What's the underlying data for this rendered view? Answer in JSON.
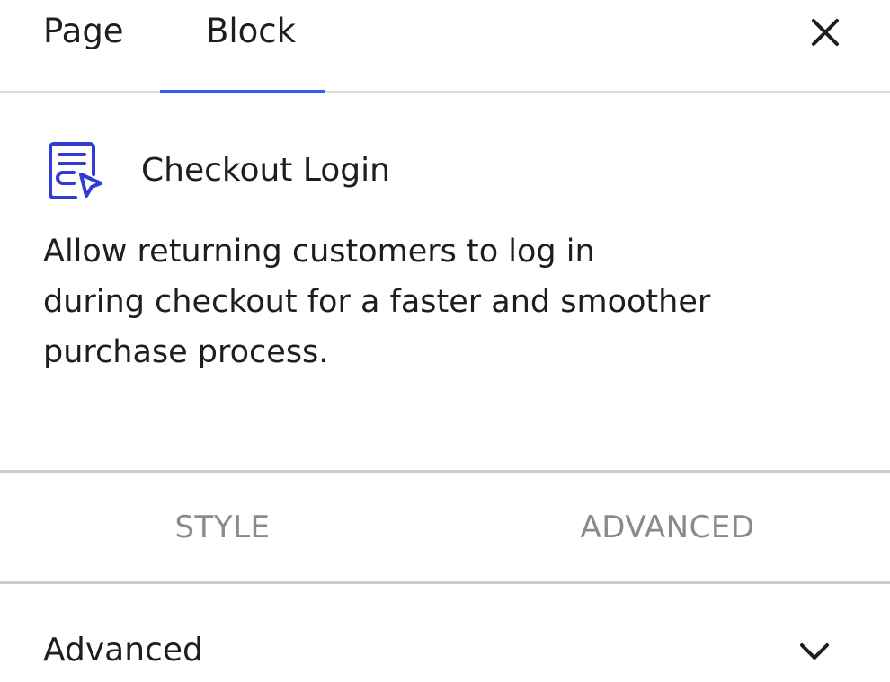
{
  "header": {
    "tabs": [
      {
        "label": "Page",
        "active": false
      },
      {
        "label": "Block",
        "active": true
      }
    ],
    "close_icon": "close-icon",
    "accent_color": "#3858e9"
  },
  "block": {
    "icon": "checkout-login-icon",
    "icon_color": "#2f3bd1",
    "title": "Checkout Login",
    "description_lines": [
      "Allow returning customers to log in",
      "during checkout for a faster and smoother",
      "purchase process."
    ]
  },
  "sub_tabs": [
    {
      "label": "STYLE"
    },
    {
      "label": "ADVANCED"
    }
  ],
  "accordion": {
    "title": "Advanced",
    "icon": "chevron-down-icon",
    "expanded": false
  }
}
